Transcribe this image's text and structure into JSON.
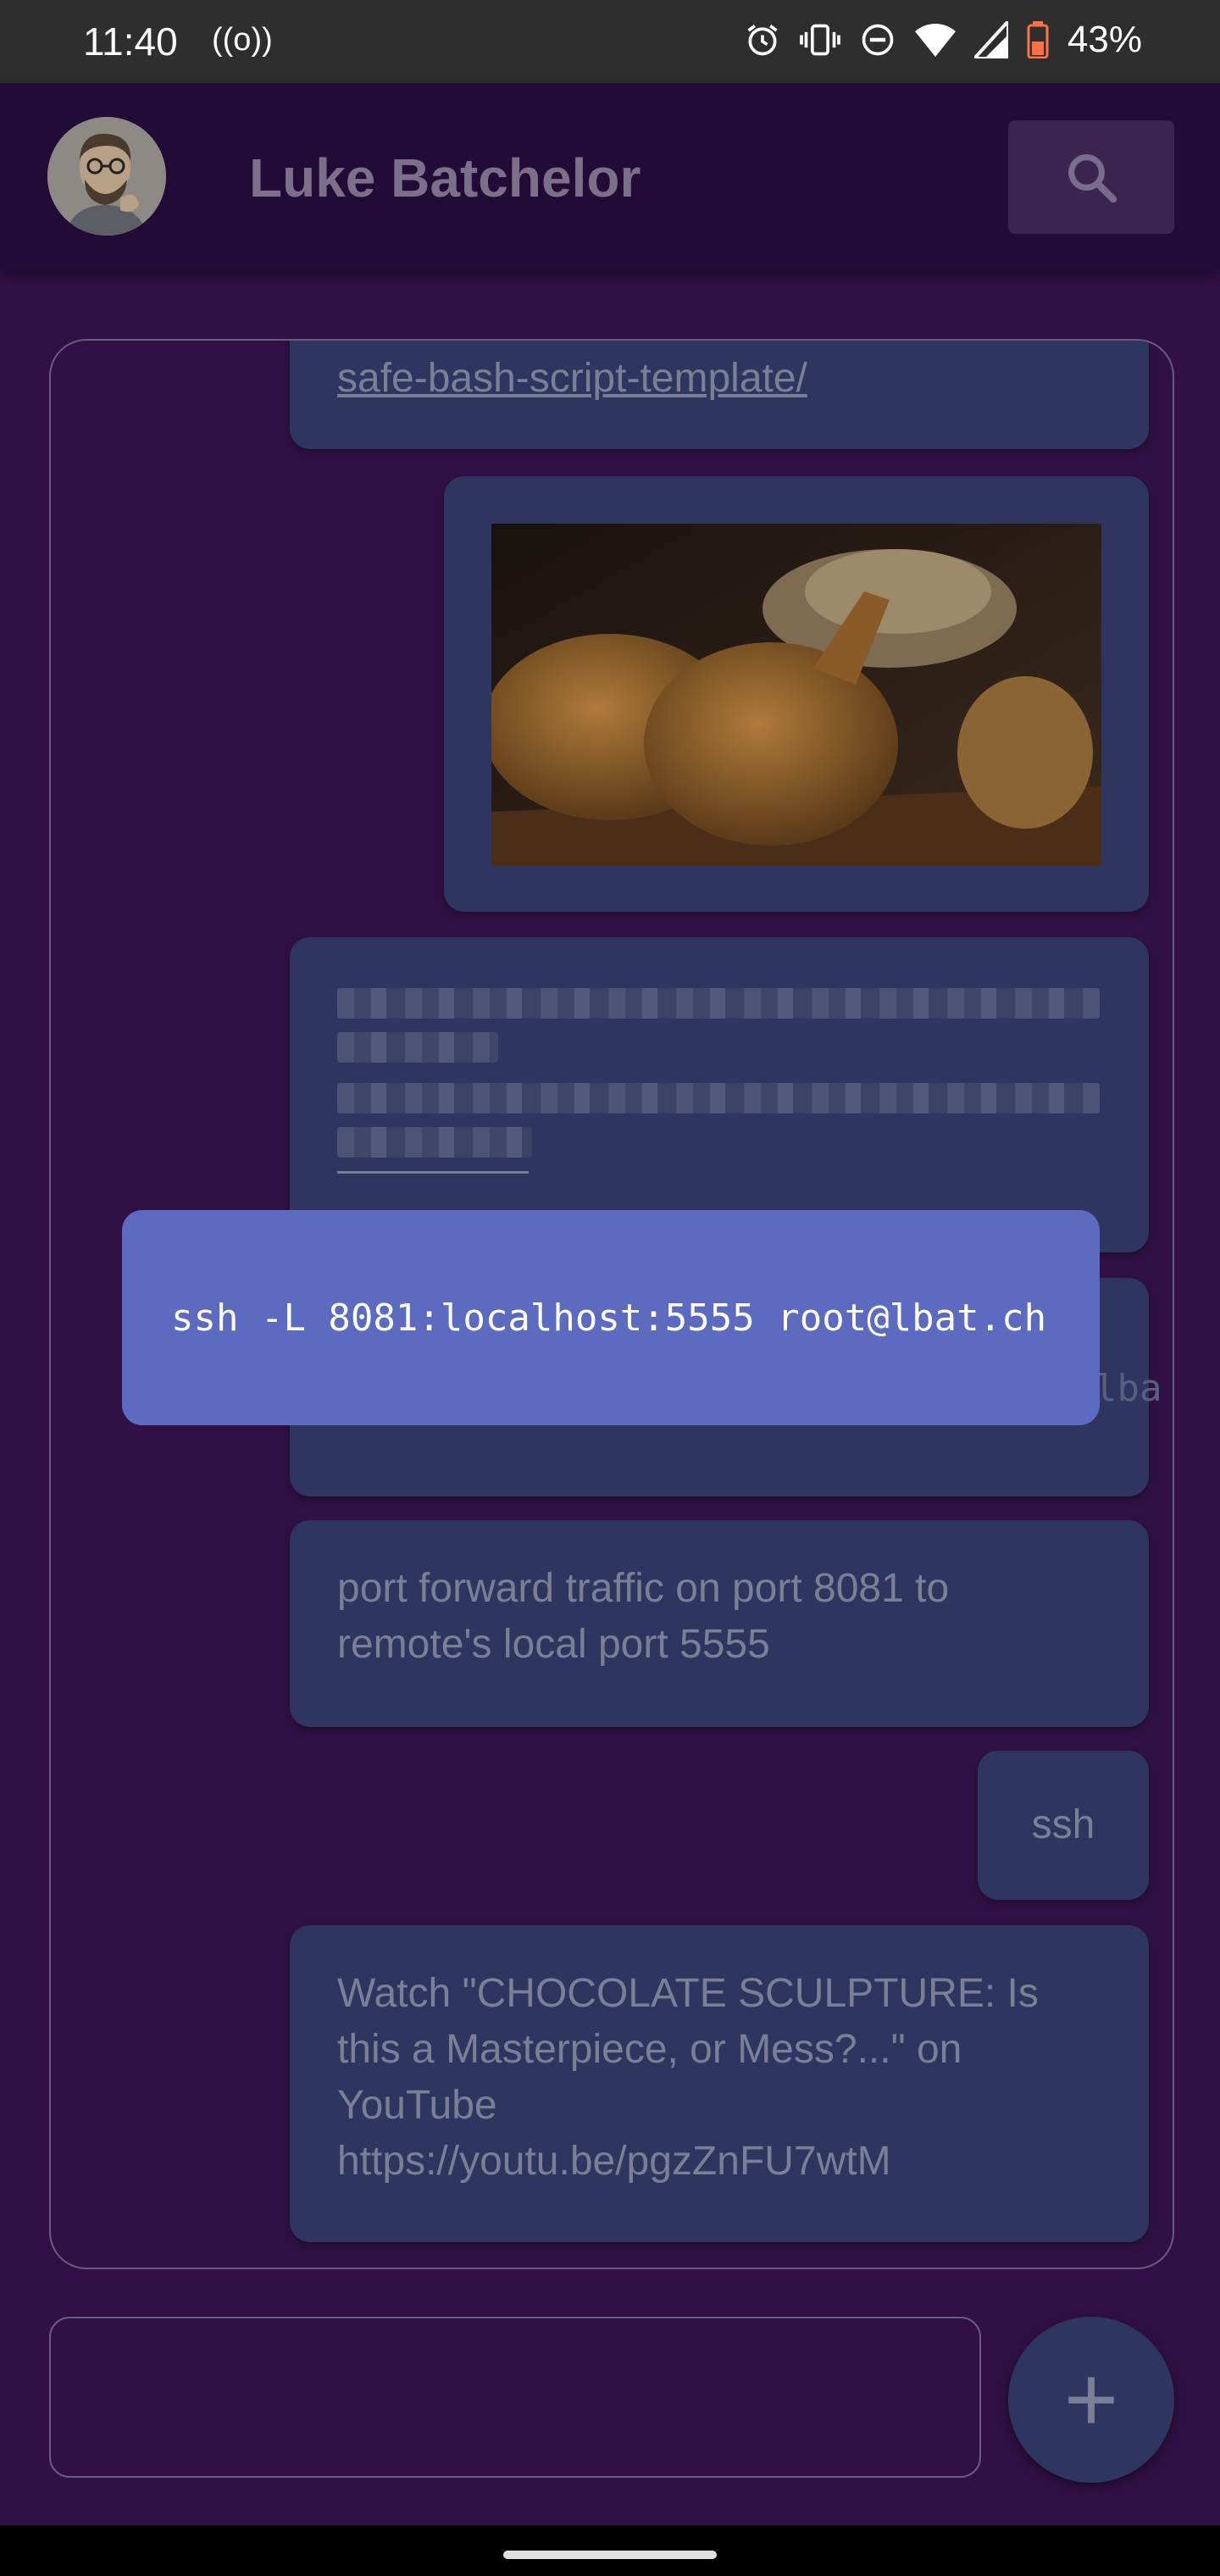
{
  "status_bar": {
    "time": "11:40",
    "radio_icon": "((o))",
    "battery": "43%",
    "icons": [
      "alarm-icon",
      "vibrate-icon",
      "dnd-icon",
      "wifi-icon",
      "signal-icon",
      "battery-icon"
    ]
  },
  "app_bar": {
    "title": "Luke Batchelor",
    "search_icon": "search-icon"
  },
  "messages": {
    "link_fragment": "safe-bash-script-template/",
    "image_alt": "fried chicken photo",
    "reply_preview_fragment": "lba",
    "port_forward": "port forward traffic on port 8081 to remote's local port 5555",
    "ssh": "ssh",
    "youtube_line1": "Watch \"CHOCOLATE SCULPTURE: Is this a Masterpiece, or Mess?...\" on YouTube",
    "youtube_link": "https://youtu.be/pgzZnFU7wtM"
  },
  "tooltip": {
    "text": "ssh -L 8081:localhost:5555 root@lbat.ch"
  },
  "composer": {
    "input_value": "",
    "fab_label": "+"
  },
  "colors": {
    "background": "#311145",
    "app_bar": "#230b37",
    "bubble": "#2e3660",
    "tooltip": "#5c6bc0"
  }
}
